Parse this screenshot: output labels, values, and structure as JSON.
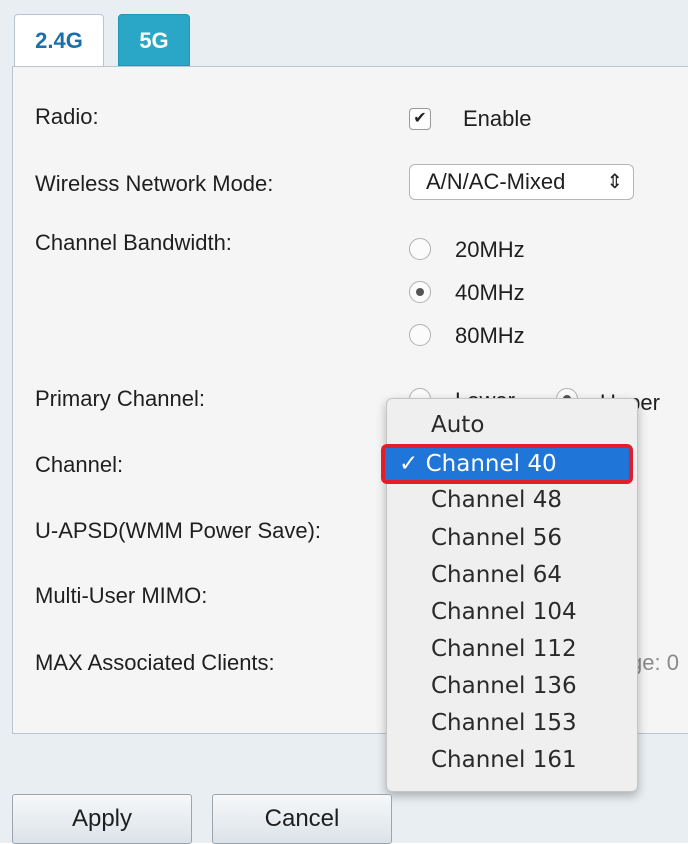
{
  "tabs": [
    {
      "label": "2.4G",
      "active": false
    },
    {
      "label": "5G",
      "active": true
    }
  ],
  "form": {
    "radio": {
      "label": "Radio:",
      "checkbox_label": "Enable",
      "checked": true
    },
    "wireless_mode": {
      "label": "Wireless Network Mode:",
      "value": "A/N/AC-Mixed"
    },
    "channel_bandwidth": {
      "label": "Channel Bandwidth:",
      "options": [
        "20MHz",
        "40MHz",
        "80MHz"
      ],
      "selected": "40MHz"
    },
    "primary_channel": {
      "label": "Primary Channel:",
      "options": [
        "Lower",
        "Upper"
      ],
      "selected": "Upper"
    },
    "channel": {
      "label": "Channel:"
    },
    "uapsd": {
      "label": "U-APSD(WMM Power Save):"
    },
    "mu_mimo": {
      "label": "Multi-User MIMO:"
    },
    "max_clients": {
      "label": "MAX Associated Clients:",
      "hint_fragment": "ge: 0"
    }
  },
  "channel_dropdown": {
    "items": [
      "Auto",
      "Channel 40",
      "Channel 48",
      "Channel 56",
      "Channel 64",
      "Channel 104",
      "Channel 112",
      "Channel 136",
      "Channel 153",
      "Channel 161"
    ],
    "selected_item": "Channel 40",
    "check_mark": "✓"
  },
  "buttons": {
    "apply": "Apply",
    "cancel": "Cancel"
  },
  "colors": {
    "active_tab": "#2aa7c6",
    "selection_highlight": "#1f76d8",
    "annotation_outline": "#e31e2b"
  }
}
